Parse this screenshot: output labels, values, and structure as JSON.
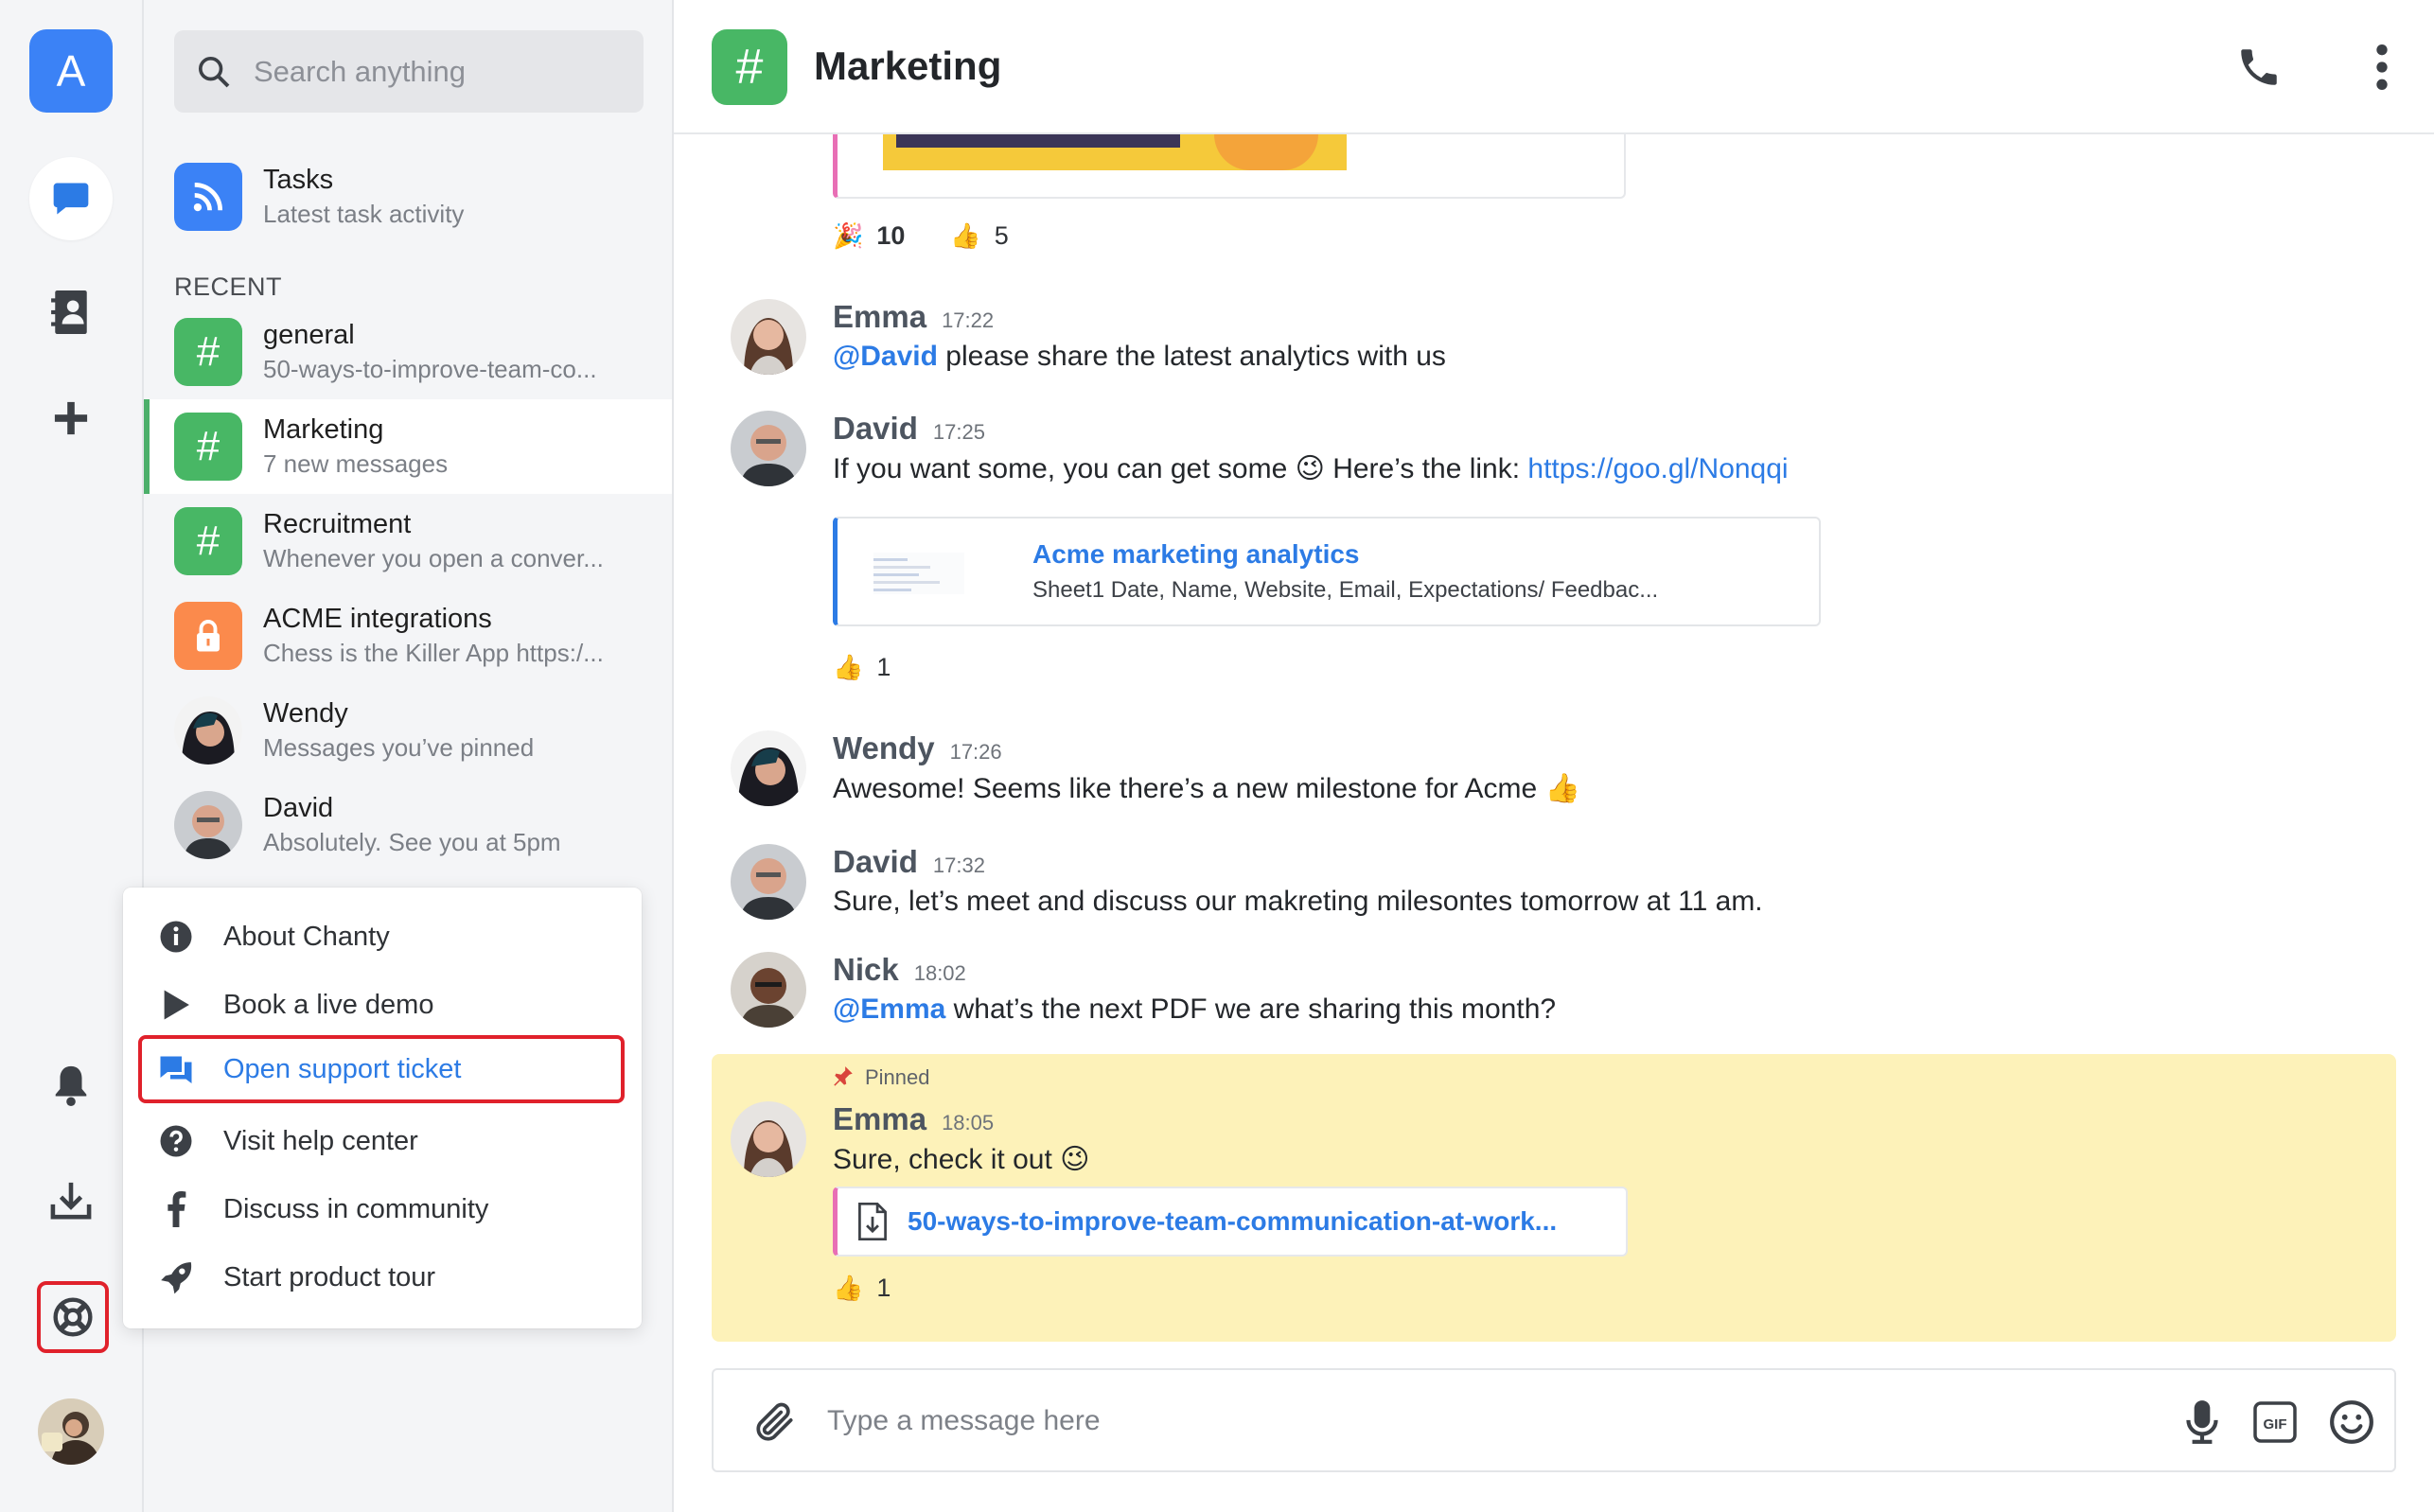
{
  "rail": {
    "workspace_initial": "A"
  },
  "sidebar": {
    "search_placeholder": "Search anything",
    "tasks": {
      "title": "Tasks",
      "subtitle": "Latest task activity"
    },
    "recent_label": "RECENT",
    "conversations": [
      {
        "title": "general",
        "subtitle": "50-ways-to-improve-team-co...",
        "icon": "hash-icon",
        "color": "#48b765"
      },
      {
        "title": "Marketing",
        "subtitle": "7 new messages",
        "icon": "hash-icon",
        "color": "#48b765",
        "active": true
      },
      {
        "title": "Recruitment",
        "subtitle": "Whenever you open a conver...",
        "icon": "hash-icon",
        "color": "#48b765"
      },
      {
        "title": "ACME integrations",
        "subtitle": "Chess is the Killer App https:/...",
        "icon": "lock-icon",
        "color": "#fb8a4c"
      },
      {
        "title": "Wendy",
        "subtitle": "Messages you’ve pinned",
        "icon": "avatar"
      },
      {
        "title": "David",
        "subtitle": "Absolutely. See you at 5pm",
        "icon": "avatar"
      }
    ]
  },
  "help_menu": {
    "items": [
      {
        "label": "About Chanty",
        "icon": "info-icon"
      },
      {
        "label": "Book a live demo",
        "icon": "play-icon"
      },
      {
        "label": "Open support ticket",
        "icon": "chat-bubbles-icon",
        "highlighted": true
      },
      {
        "label": "Visit help center",
        "icon": "question-icon"
      },
      {
        "label": "Discuss in community",
        "icon": "facebook-icon"
      },
      {
        "label": "Start product tour",
        "icon": "rocket-icon"
      }
    ]
  },
  "chat": {
    "title": "Marketing",
    "hash": "#",
    "top_reactions": [
      {
        "emoji": "🎉",
        "count": "10"
      },
      {
        "emoji": "👍",
        "count": "5"
      }
    ],
    "messages": [
      {
        "name": "Emma",
        "time": "17:22",
        "mention": "@David",
        "text": " please share the latest analytics with us"
      },
      {
        "name": "David",
        "time": "17:25",
        "text": "If you want some, you can get some 😉 Here’s the link: ",
        "link": "https://goo.gl/Nonqqi"
      },
      {
        "name": "Wendy",
        "time": "17:26",
        "text": "Awesome! Seems like there’s a new milestone for Acme 👍"
      },
      {
        "name": "David",
        "time": "17:32",
        "text": "Sure, let’s meet and discuss our makreting milesontes tomorrow at 11 am."
      },
      {
        "name": "Nick",
        "time": "18:02",
        "mention": "@Emma",
        "text": " what’s the next PDF we are sharing this month?"
      }
    ],
    "link_preview": {
      "title": "Acme marketing analytics",
      "description": "Sheet1 Date, Name, Website, Email, Expectations/ Feedbac..."
    },
    "david_reaction": {
      "emoji": "👍",
      "count": "1"
    },
    "pinned": {
      "label": "Pinned",
      "name": "Emma",
      "time": "18:05",
      "text": "Sure, check it out 😉",
      "file": "50-ways-to-improve-team-communication-at-work...",
      "reaction": {
        "emoji": "👍",
        "count": "1"
      }
    },
    "composer_placeholder": "Type a message here",
    "gif_label": "GIF"
  }
}
